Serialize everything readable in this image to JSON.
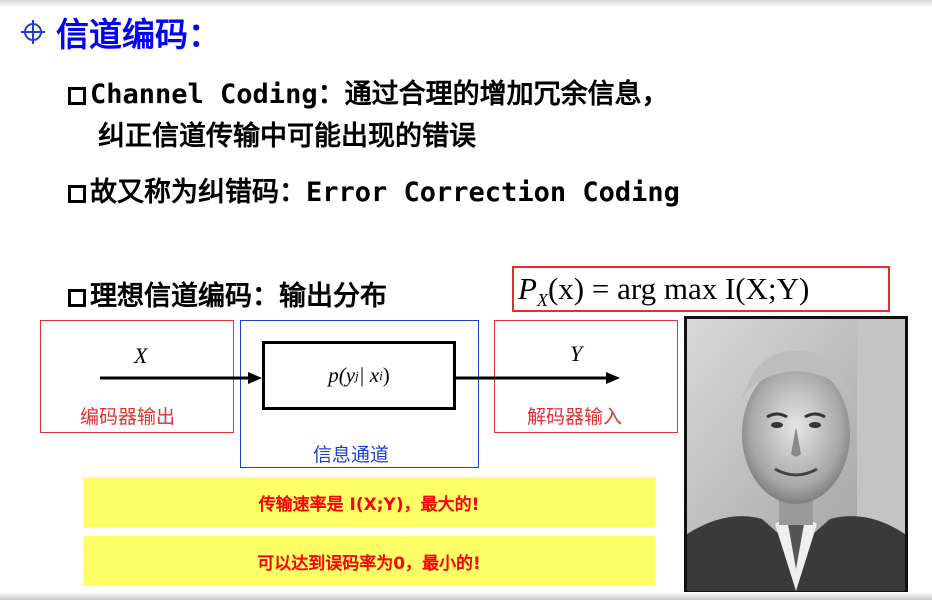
{
  "title": "信道编码：",
  "bullets": {
    "b1_line1_prefix": "Channel Coding",
    "b1_line1_suffix": "：通过合理的增加冗余信息，",
    "b1_line2": "纠正信道传输中可能出现的错误",
    "b2_prefix": "故又称为纠错码：",
    "b2_suffix": "Error Correction Coding",
    "b3": "理想信道编码：输出分布"
  },
  "formula": {
    "lhs_var": "P",
    "lhs_sub": "X",
    "lhs_arg": "(x)",
    "rhs": "= arg max I(X;Y)"
  },
  "diagram": {
    "input_var": "X",
    "output_var": "Y",
    "channel_func": "p(y",
    "channel_sub_j": "j",
    "channel_mid": " | x",
    "channel_sub_i": "i",
    "channel_end": ")",
    "encoder_label": "编码器输出",
    "decoder_label": "解码器输入",
    "channel_label": "信息通道"
  },
  "highlights": {
    "h1": "传输速率是 I(X;Y)，最大的!",
    "h2": "可以达到误码率为0，最小的!"
  },
  "colors": {
    "title": "#0000ff",
    "red": "#e03030",
    "blue": "#1f3fd0",
    "highlight_bg": "#ffff66",
    "highlight_text": "#ff0000"
  }
}
